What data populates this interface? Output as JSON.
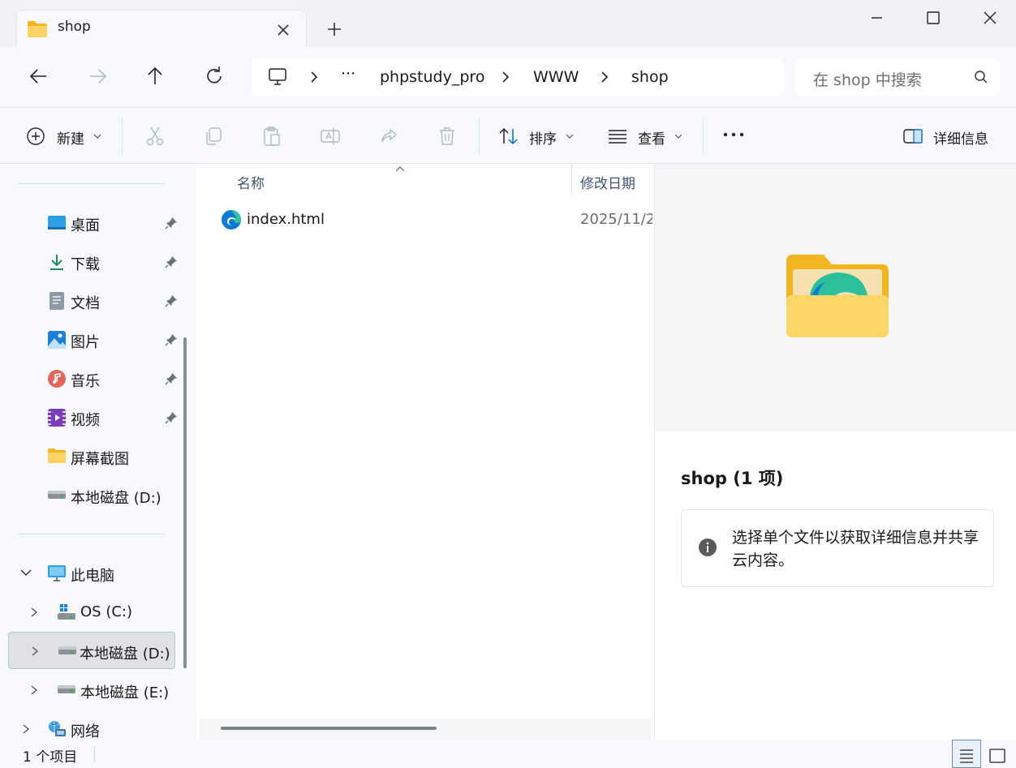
{
  "tab": {
    "title": "shop",
    "folder_icon": "folder-icon",
    "close_icon": "close-icon"
  },
  "window": {
    "new_tab_icon": "plus-icon",
    "minimize_icon": "minimize-icon",
    "maximize_icon": "maximize-icon",
    "close_icon": "close-icon"
  },
  "nav": {
    "back_icon": "arrow-left-icon",
    "forward_icon": "arrow-right-icon",
    "up_icon": "arrow-up-icon",
    "refresh_icon": "refresh-icon",
    "breadcrumb": {
      "root_icon": "monitor-icon",
      "overflow": "···",
      "items": [
        "phpstudy_pro",
        "WWW",
        "shop"
      ]
    },
    "search_placeholder": "在 shop 中搜索"
  },
  "toolbar": {
    "new_label": "新建",
    "sort_label": "排序",
    "view_label": "查看",
    "more_label": "···",
    "details_label": "详细信息",
    "disabled_actions": [
      "cut-icon",
      "copy-icon",
      "paste-icon",
      "rename-icon",
      "share-icon",
      "delete-icon"
    ]
  },
  "sidebar": {
    "quick_access": [
      {
        "label": "桌面",
        "icon": "desktop-icon",
        "pinned": true
      },
      {
        "label": "下载",
        "icon": "download-icon",
        "pinned": true
      },
      {
        "label": "文档",
        "icon": "document-icon",
        "pinned": true
      },
      {
        "label": "图片",
        "icon": "pictures-icon",
        "pinned": true
      },
      {
        "label": "音乐",
        "icon": "music-icon",
        "pinned": true
      },
      {
        "label": "视频",
        "icon": "video-icon",
        "pinned": true
      },
      {
        "label": "屏幕截图",
        "icon": "folder-icon",
        "pinned": false
      },
      {
        "label": "本地磁盘 (D:)",
        "icon": "drive-icon",
        "pinned": false
      }
    ],
    "this_pc": {
      "label": "此电脑",
      "expanded": true,
      "children": [
        {
          "label": "OS (C:)",
          "icon": "windows-drive-icon"
        },
        {
          "label": "本地磁盘 (D:)",
          "icon": "drive-icon",
          "selected": true
        },
        {
          "label": "本地磁盘 (E:)",
          "icon": "drive-icon"
        }
      ]
    },
    "network": {
      "label": "网络"
    }
  },
  "files": {
    "columns": [
      "名称",
      "修改日期"
    ],
    "rows": [
      {
        "name": "index.html",
        "modified": "2025/11/2",
        "icon": "edge-icon"
      }
    ]
  },
  "details": {
    "title": "shop (1 项)",
    "message": "选择单个文件以获取详细信息并共享云内容。"
  },
  "status": {
    "item_count": "1 个项目"
  },
  "colors": {
    "window_bg": "#f0f2f6",
    "pane_bg": "#f7f9fc",
    "accent": "#0067c0",
    "folder_yellow": "#f8c94b"
  }
}
